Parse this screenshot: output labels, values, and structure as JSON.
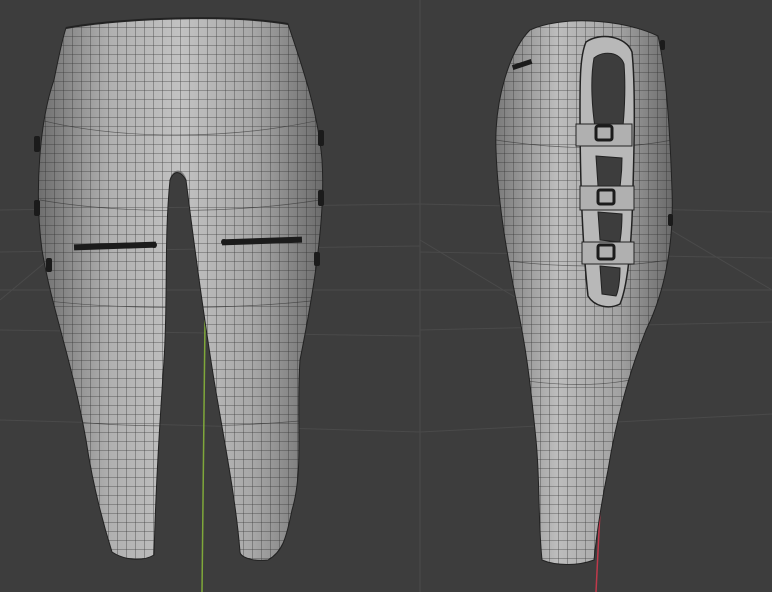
{
  "viewport": {
    "background": "#3d3d3d",
    "grid_color": "#4a4a4a",
    "y_axis_color": "#7fa83a",
    "x_axis_color": "#c0394b"
  },
  "mesh": {
    "fill": "#a4a4a4",
    "wire": "#2a2a2a",
    "detail": "#1b1b1b"
  },
  "views": [
    {
      "name": "front-view"
    },
    {
      "name": "side-view"
    }
  ]
}
